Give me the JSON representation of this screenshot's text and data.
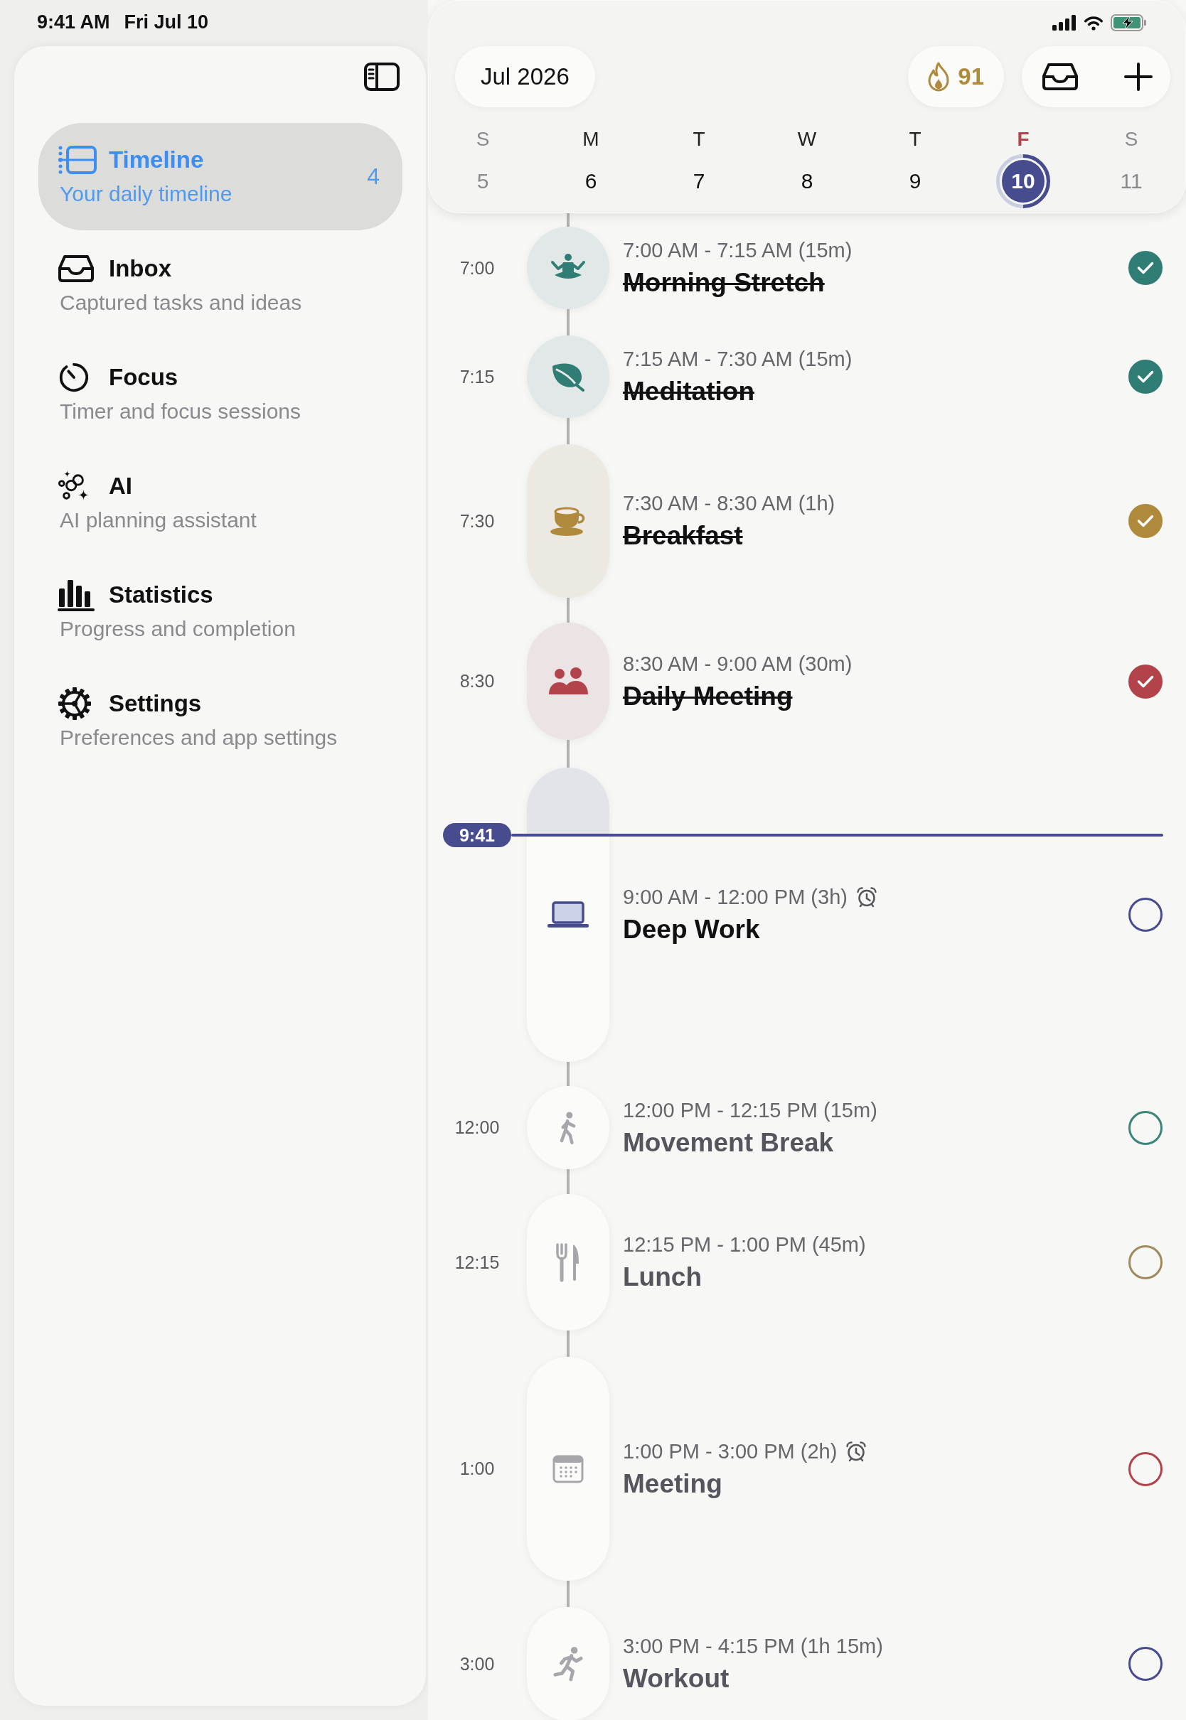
{
  "status_bar": {
    "time": "9:41 AM",
    "date": "Fri Jul 10"
  },
  "sidebar": {
    "items": [
      {
        "title": "Timeline",
        "subtitle": "Your daily timeline",
        "count": "4",
        "selected": true
      },
      {
        "title": "Inbox",
        "subtitle": "Captured tasks and ideas",
        "selected": false
      },
      {
        "title": "Focus",
        "subtitle": "Timer and focus sessions",
        "selected": false
      },
      {
        "title": "AI",
        "subtitle": "AI planning assistant",
        "selected": false
      },
      {
        "title": "Statistics",
        "subtitle": "Progress and completion",
        "selected": false
      },
      {
        "title": "Settings",
        "subtitle": "Preferences and app settings",
        "selected": false
      }
    ]
  },
  "header": {
    "month": "Jul 2026",
    "streak": "91"
  },
  "week": [
    {
      "letter": "S",
      "number": "5",
      "weekend": true,
      "selected": false
    },
    {
      "letter": "M",
      "number": "6",
      "weekend": false,
      "selected": false
    },
    {
      "letter": "T",
      "number": "7",
      "weekend": false,
      "selected": false
    },
    {
      "letter": "W",
      "number": "8",
      "weekend": false,
      "selected": false
    },
    {
      "letter": "T",
      "number": "9",
      "weekend": false,
      "selected": false
    },
    {
      "letter": "F",
      "number": "10",
      "weekend": false,
      "selected": true,
      "level": 0.5
    },
    {
      "letter": "S",
      "number": "11",
      "weekend": true,
      "selected": false
    }
  ],
  "timeline": {
    "events": [
      {
        "time": "7:00",
        "range": "7:00 AM - 7:15 AM (15m)",
        "title": "Morning Stretch",
        "color": "#2f7d74",
        "done": true,
        "current": false,
        "alarm": false
      },
      {
        "time": "7:15",
        "range": "7:15 AM - 7:30 AM (15m)",
        "title": "Meditation",
        "color": "#2f7d74",
        "done": true,
        "current": false,
        "alarm": false
      },
      {
        "time": "7:30",
        "range": "7:30 AM - 8:30 AM (1h)",
        "title": "Breakfast",
        "color": "#b08a3c",
        "done": true,
        "current": false,
        "alarm": false
      },
      {
        "time": "8:30",
        "range": "8:30 AM - 9:00 AM (30m)",
        "title": "Daily Meeting",
        "color": "#b3434b",
        "done": true,
        "current": false,
        "alarm": false
      },
      {
        "range": "9:00 AM - 12:00 PM (3h)",
        "title": "Deep Work",
        "color": "#464c8d",
        "done": false,
        "current": true,
        "alarm": true,
        "level": 0.23,
        "now_label": "9:41"
      },
      {
        "time": "12:00",
        "range": "12:00 PM - 12:15 PM (15m)",
        "title": "Movement Break",
        "color": "#3b8479",
        "done": false,
        "current": false,
        "alarm": false
      },
      {
        "time": "12:15",
        "range": "12:15 PM - 1:00 PM (45m)",
        "title": "Lunch",
        "color": "#a08a5c",
        "done": false,
        "current": false,
        "alarm": false
      },
      {
        "time": "1:00",
        "range": "1:00 PM - 3:00 PM (2h)",
        "title": "Meeting",
        "color": "#b3434b",
        "done": false,
        "current": false,
        "alarm": true
      },
      {
        "time": "3:00",
        "range": "3:00 PM - 4:15 PM (1h 15m)",
        "title": "Workout",
        "color": "#464c8d",
        "done": false,
        "current": false,
        "alarm": false
      }
    ]
  }
}
